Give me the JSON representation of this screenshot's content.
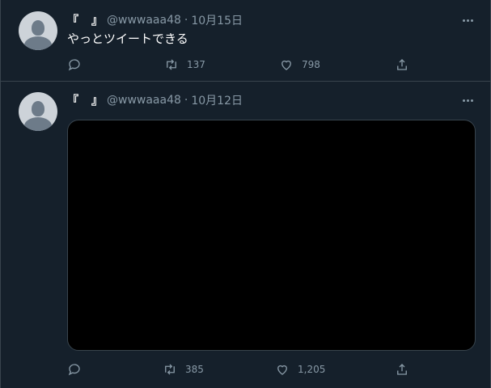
{
  "tweets": [
    {
      "name": "『　』",
      "handle": "@wwwaaa48",
      "separator": "·",
      "date": "10月15日",
      "text": "やっとツイートできる",
      "retweets": "137",
      "likes": "798",
      "has_media": false
    },
    {
      "name": "『　』",
      "handle": "@wwwaaa48",
      "separator": "·",
      "date": "10月12日",
      "text": "",
      "retweets": "385",
      "likes": "1,205",
      "has_media": true
    }
  ],
  "icons": {
    "reply": "reply-icon",
    "retweet": "retweet-icon",
    "like": "like-icon",
    "share": "share-icon",
    "more": "more-icon"
  },
  "colors": {
    "background": "#15202b",
    "border": "#38444d",
    "muted_text": "#8899a6",
    "primary_text": "#ffffff",
    "avatar_bg": "#cdd3d9"
  }
}
